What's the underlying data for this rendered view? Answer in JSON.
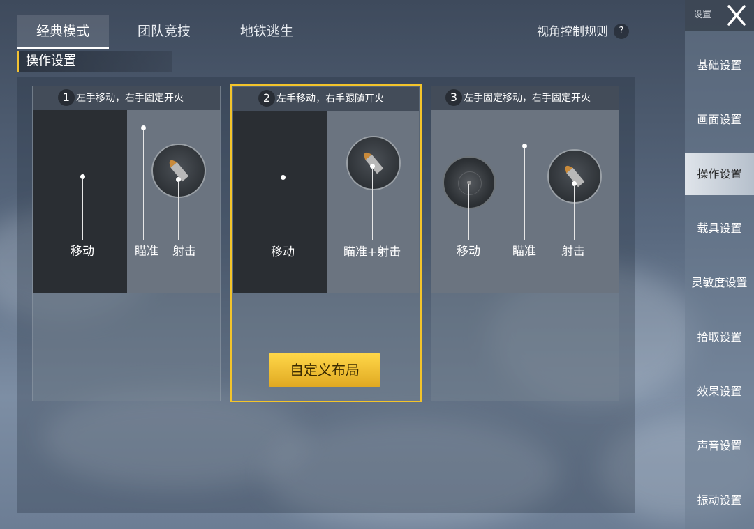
{
  "tabs": [
    {
      "label": "经典模式",
      "active": true
    },
    {
      "label": "团队竞技",
      "active": false
    },
    {
      "label": "地铁逃生",
      "active": false
    }
  ],
  "rule_link": "视角控制规则",
  "help_icon": "?",
  "section_title": "操作设置",
  "cards": [
    {
      "num": "1",
      "title": "左手移动，右手固定开火",
      "labels": [
        "移动",
        "瞄准",
        "射击"
      ],
      "selected": false
    },
    {
      "num": "2",
      "title": "左手移动，右手跟随开火",
      "labels": [
        "移动",
        "瞄准+射击"
      ],
      "selected": true
    },
    {
      "num": "3",
      "title": "左手固定移动，右手固定开火",
      "labels": [
        "移动",
        "瞄准",
        "射击"
      ],
      "selected": false
    }
  ],
  "custom_layout_button": "自定义布局",
  "sidebar": {
    "title": "设置",
    "items": [
      "基础设置",
      "画面设置",
      "操作设置",
      "载具设置",
      "灵敏度设置",
      "拾取设置",
      "效果设置",
      "声音设置",
      "振动设置"
    ],
    "active_index": 2
  },
  "colors": {
    "accent": "#f2c233",
    "button": "#ffd749"
  }
}
